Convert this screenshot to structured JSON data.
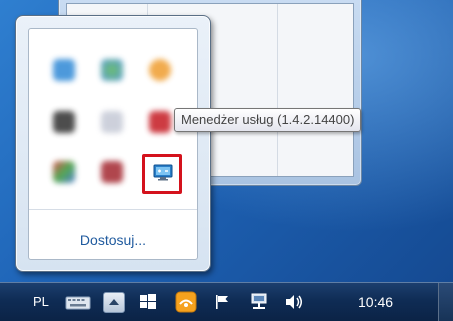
{
  "flyout": {
    "customize_label": "Dostosuj..."
  },
  "tooltip": {
    "text": "Menedżer usług (1.4.2.14400)"
  },
  "taskbar": {
    "language": "PL",
    "clock": "10:46"
  },
  "icons": {
    "highlighted": "service-manager-icon",
    "highlight_color": "#d4121c"
  }
}
